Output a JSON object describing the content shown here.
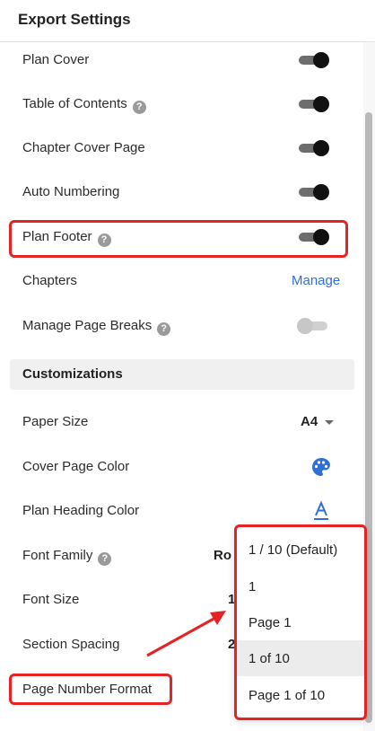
{
  "header": {
    "title": "Export Settings"
  },
  "settings": [
    {
      "label": "Plan Cover",
      "help": false,
      "control": "toggle",
      "on": true
    },
    {
      "label": "Table of Contents",
      "help": true,
      "control": "toggle",
      "on": true
    },
    {
      "label": "Chapter Cover Page",
      "help": false,
      "control": "toggle",
      "on": true
    },
    {
      "label": "Auto Numbering",
      "help": false,
      "control": "toggle",
      "on": true
    },
    {
      "label": "Plan Footer",
      "help": true,
      "control": "toggle",
      "on": true
    },
    {
      "label": "Chapters",
      "help": false,
      "control": "link",
      "link_label": "Manage"
    },
    {
      "label": "Manage Page Breaks",
      "help": true,
      "control": "toggle",
      "on": false
    }
  ],
  "customizations": {
    "title": "Customizations",
    "paper_size": {
      "label": "Paper Size",
      "value": "A4"
    },
    "cover_page_color": {
      "label": "Cover Page Color",
      "icon": "palette-icon"
    },
    "plan_heading_color": {
      "label": "Plan Heading Color",
      "icon": "font-color-icon",
      "glyph": "A"
    },
    "font_family": {
      "label": "Font Family",
      "help": true,
      "value_partial": "Ro"
    },
    "font_size": {
      "label": "Font Size",
      "value_partial": "1"
    },
    "section_spacing": {
      "label": "Section Spacing",
      "value_partial": "2"
    },
    "page_number_format": {
      "label": "Page Number Format"
    }
  },
  "page_number_dropdown": {
    "options": [
      "1 / 10 (Default)",
      "1",
      "Page 1",
      "1 of 10",
      "Page 1 of 10"
    ],
    "hovered": "1 of 10"
  },
  "colors": {
    "accent_link": "#2f6fd8",
    "highlight": "#e52323",
    "toggle_on_knob": "#111111",
    "palette_icon": "#2f6fd8"
  },
  "help_glyph": "?"
}
